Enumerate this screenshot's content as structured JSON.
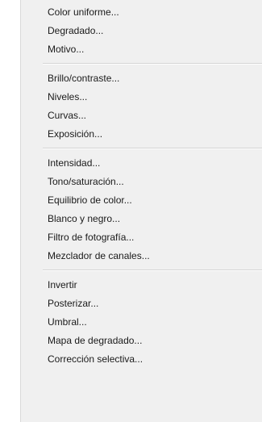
{
  "menu": {
    "groups": [
      {
        "items": [
          "Color uniforme...",
          "Degradado...",
          "Motivo..."
        ]
      },
      {
        "items": [
          "Brillo/contraste...",
          "Niveles...",
          "Curvas...",
          "Exposición..."
        ]
      },
      {
        "items": [
          "Intensidad...",
          "Tono/saturación...",
          "Equilibrio de color...",
          "Blanco y negro...",
          "Filtro de fotografía...",
          "Mezclador de canales..."
        ]
      },
      {
        "items": [
          "Invertir",
          "Posterizar...",
          "Umbral...",
          "Mapa de degradado...",
          "Corrección selectiva..."
        ]
      }
    ]
  }
}
